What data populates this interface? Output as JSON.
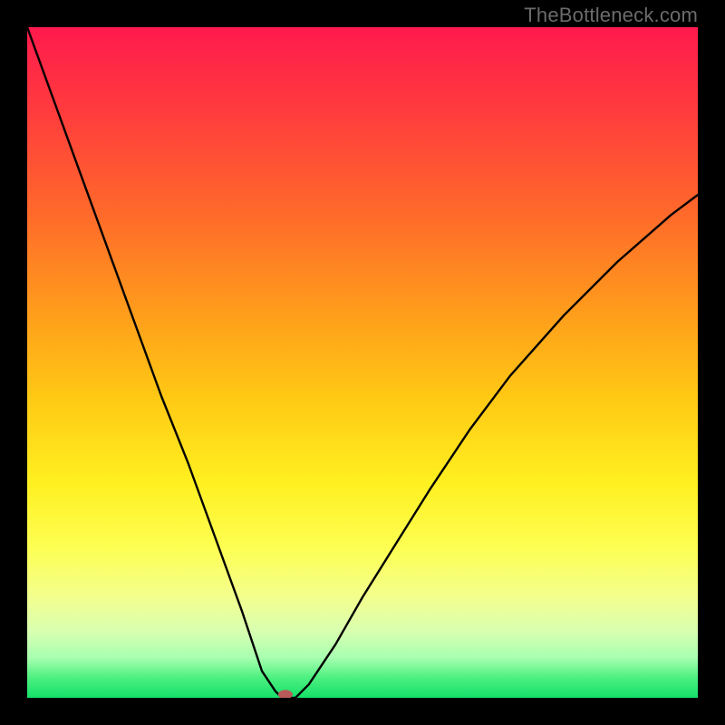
{
  "watermark": "TheBottleneck.com",
  "chart_data": {
    "type": "line",
    "title": "",
    "xlabel": "",
    "ylabel": "",
    "xlim": [
      0,
      100
    ],
    "ylim": [
      0,
      100
    ],
    "background_gradient": {
      "orientation": "vertical",
      "stops": [
        {
          "pos": 0,
          "color": "#ff1a4d"
        },
        {
          "pos": 28,
          "color": "#ff6a2a"
        },
        {
          "pos": 55,
          "color": "#ffc814"
        },
        {
          "pos": 78,
          "color": "#fdff55"
        },
        {
          "pos": 94,
          "color": "#a8ffb0"
        },
        {
          "pos": 100,
          "color": "#14e06a"
        }
      ]
    },
    "series": [
      {
        "name": "bottleneck-curve",
        "color": "#000000",
        "x": [
          0,
          4,
          8,
          12,
          16,
          20,
          24,
          28,
          32,
          35,
          37,
          38,
          40,
          42,
          46,
          50,
          55,
          60,
          66,
          72,
          80,
          88,
          96,
          100
        ],
        "y": [
          100,
          89,
          78,
          67,
          56,
          45,
          35,
          24,
          13,
          4,
          1,
          0,
          0,
          2,
          8,
          15,
          23,
          31,
          40,
          48,
          57,
          65,
          72,
          75
        ]
      }
    ],
    "marker": {
      "name": "min-marker",
      "x": 38.5,
      "y": 0.5,
      "color": "#b85a5a",
      "rx": 8,
      "ry": 5
    }
  }
}
